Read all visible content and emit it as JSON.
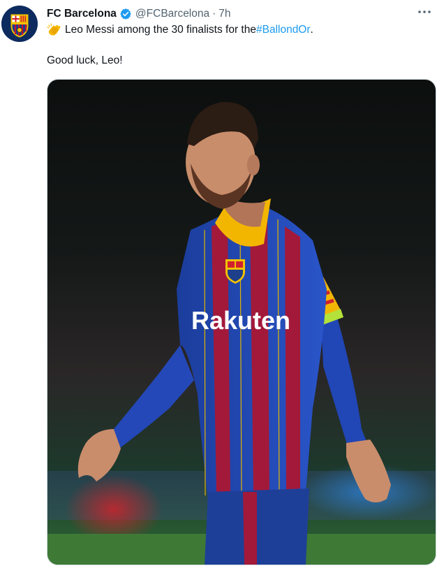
{
  "tweet": {
    "author_name": "FC Barcelona",
    "handle": "@FCBarcelona",
    "separator": "·",
    "time": "7h",
    "text_line1": "Leo Messi among the 30 finalists for the ",
    "hashtag": "#BallondOr",
    "text_line1_end": ".",
    "text_line2": "Good luck, Leo!",
    "icons": {
      "avatar": "fc-barcelona-crest",
      "verified": "verified-badge-icon",
      "emoji": "clapping-hands-icon",
      "more": "more-options-icon"
    },
    "media": {
      "jersey_sponsor": "Rakuten"
    },
    "colors": {
      "accent": "#1d9bf0",
      "secondary_text": "#536471"
    }
  }
}
